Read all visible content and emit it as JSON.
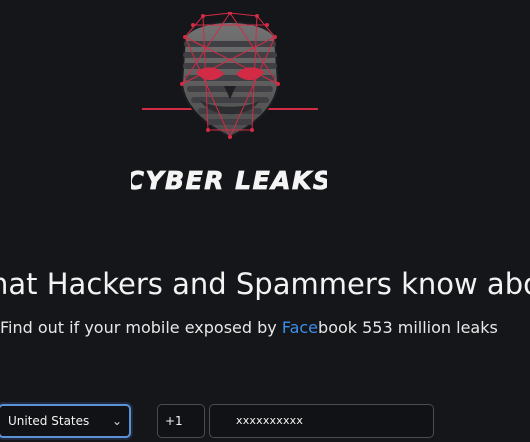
{
  "brand": {
    "name": "CYBER LEAKS"
  },
  "hero": {
    "headline": "hat Hackers and Spammers know about",
    "sub_prefix": "Find out if your mobile exposed by ",
    "sub_highlight": "Face",
    "sub_suffix": "book 553 million leaks"
  },
  "form": {
    "country": "United States",
    "country_code": "+1",
    "phone_value": "xxxxxxxxxx"
  },
  "colors": {
    "background": "#15161a",
    "accent_red": "#d32b45",
    "link_blue": "#3b8fe8",
    "focus_blue": "#5d91d6"
  },
  "icons": {
    "logo": "hacker-mask-icon",
    "select": "chevron-down-icon"
  }
}
